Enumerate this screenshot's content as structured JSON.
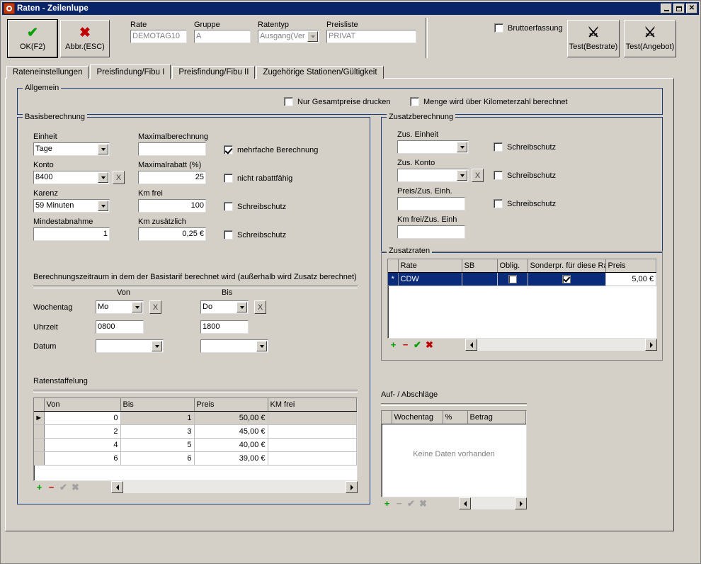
{
  "window": {
    "title": "Raten - Zeilenlupe",
    "minimize": "_",
    "maximize": "□",
    "close": "×"
  },
  "toolbar": {
    "ok_label": "OK(F2)",
    "ok_icon": "check-icon",
    "cancel_label": "Abbr.(ESC)",
    "cancel_icon": "x-icon",
    "fields": [
      {
        "label": "Rate",
        "value": "DEMOTAG10"
      },
      {
        "label": "Gruppe",
        "value": "A"
      },
      {
        "label": "Ratentyp",
        "value": "Ausgang(Ver"
      },
      {
        "label": "Preisliste",
        "value": "PRIVAT"
      }
    ],
    "brutto_label": "Bruttoerfassung",
    "brutto_checked": false,
    "test_bestrate_label": "Test(Bestrate)",
    "test_angebot_label": "Test(Angebot)",
    "test_icon": "tools-icon"
  },
  "tabs": [
    {
      "label": "Rateneinstellungen",
      "selected": false
    },
    {
      "label": "Preisfindung/Fibu I",
      "selected": true
    },
    {
      "label": "Preisfindung/Fibu II",
      "selected": false
    },
    {
      "label": "Zugehörige Stationen/Gültigkeit",
      "selected": false
    }
  ],
  "allgemein": {
    "title": "Allgemein",
    "checkboxes": [
      {
        "label": "Nur Gesamtpreise drucken",
        "checked": false
      },
      {
        "label": "Menge wird über Kilometerzahl berechnet",
        "checked": false
      }
    ]
  },
  "basisberechnung": {
    "title": "Basisberechnung",
    "einheit_label": "Einheit",
    "einheit_value": "Tage",
    "konto_label": "Konto",
    "konto_value": "8400",
    "karenz_label": "Karenz",
    "karenz_value": "59 Minuten",
    "mindestabnahme_label": "Mindestabnahme",
    "mindestabnahme_value": "1",
    "maximalberechnung_label": "Maximalberechnung",
    "maximalberechnung_value": "",
    "maximalrabatt_label": "Maximalrabatt (%)",
    "maximalrabatt_value": "25",
    "kmfrei_label": "Km frei",
    "kmfrei_value": "100",
    "kmzus_label": "Km zusätzlich",
    "kmzus_value": "0,25 €",
    "clear_button": "X",
    "checkboxes": [
      {
        "label": "mehrfache  Berechnung",
        "checked": true
      },
      {
        "label": "nicht rabattfähig",
        "checked": false
      },
      {
        "label": "Schreibschutz",
        "checked": false
      },
      {
        "label": "Schreibschutz",
        "checked": false
      }
    ],
    "zeitraum_note": "Berechnungszeitraum in dem der Basistarif berechnet wird (außerhalb wird Zusatz berechnet)",
    "col_von": "Von",
    "col_bis": "Bis",
    "row_wochentag": "Wochentag",
    "row_uhrzeit": "Uhrzeit",
    "row_datum": "Datum",
    "wochentag_von": "Mo",
    "wochentag_bis": "Do",
    "uhrzeit_von": "0800",
    "uhrzeit_bis": "1800",
    "datum_von": "",
    "datum_bis": ""
  },
  "ratenstaffelung": {
    "title": "Ratenstaffelung",
    "columns": [
      "Von",
      "Bis",
      "Preis",
      "KM frei"
    ],
    "rows": [
      {
        "von": "0",
        "bis": "1",
        "preis": "50,00 €",
        "kmfrei": "",
        "current": true
      },
      {
        "von": "2",
        "bis": "3",
        "preis": "45,00 €",
        "kmfrei": "",
        "current": false
      },
      {
        "von": "4",
        "bis": "5",
        "preis": "40,00 €",
        "kmfrei": "",
        "current": false
      },
      {
        "von": "6",
        "bis": "6",
        "preis": "39,00 €",
        "kmfrei": "",
        "current": false
      }
    ],
    "nav": {
      "add": "+",
      "remove": "−",
      "confirm": "✔",
      "cancel": "✖"
    }
  },
  "zusatzberechnung": {
    "title": "Zusatzberechnung",
    "zus_einheit_label": "Zus. Einheit",
    "zus_einheit_value": "",
    "zus_konto_label": "Zus. Konto",
    "zus_konto_value": "",
    "preis_zus_label": "Preis/Zus. Einh.",
    "preis_zus_value": "",
    "kmfrei_zus_label": "Km frei/Zus. Einh",
    "kmfrei_zus_value": "",
    "clear_button": "X",
    "checkboxes": [
      {
        "label": "Schreibschutz",
        "checked": false
      },
      {
        "label": "Schreibschutz",
        "checked": false
      },
      {
        "label": "Schreibschutz",
        "checked": false
      }
    ]
  },
  "zusatzraten": {
    "title": "Zusatzraten",
    "columns": [
      "Rate",
      "SB",
      "Oblig.",
      "Sonderpr. für diese Rate",
      "Preis"
    ],
    "rows": [
      {
        "marker": "*",
        "rate": "CDW",
        "sb": "",
        "oblig": false,
        "sonderpreis": true,
        "preis": "5,00 €",
        "selected": true
      }
    ],
    "nav": {
      "add": "+",
      "remove": "−",
      "confirm": "✔",
      "cancel": "✖"
    }
  },
  "aufabschlaege": {
    "title": "Auf- / Abschläge",
    "columns": [
      "Wochentag",
      "%",
      "Betrag"
    ],
    "empty_message": "Keine Daten vorhanden",
    "rows": [],
    "nav": {
      "add": "+",
      "remove": "−",
      "confirm": "✔",
      "cancel": "✖"
    }
  },
  "colors": {
    "titlebar": "#0a246a",
    "face": "#d4d0c8",
    "groupborder": "#1a3a7a",
    "selection": "#0a2a7a",
    "accent_green": "#00a000",
    "accent_red": "#c00000"
  }
}
